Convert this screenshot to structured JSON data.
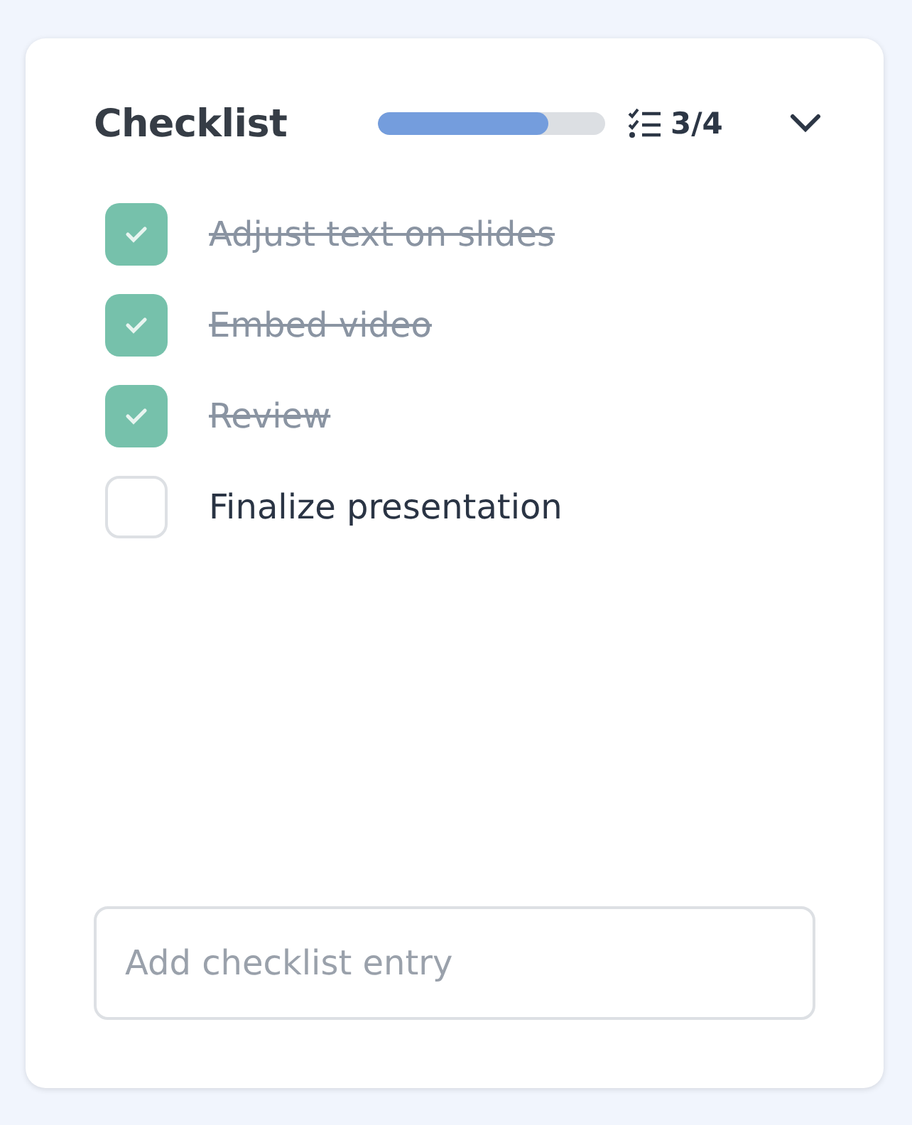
{
  "checklist": {
    "title": "Checklist",
    "progress": {
      "level": 0.75
    },
    "count": "3/4",
    "expanded": true,
    "items": [
      {
        "label": "Adjust text on slides",
        "checked": true
      },
      {
        "label": "Embed video",
        "checked": true
      },
      {
        "label": "Review",
        "checked": true
      },
      {
        "label": "Finalize presentation",
        "checked": false
      }
    ],
    "new_entry": {
      "placeholder": "Add checklist entry"
    }
  }
}
